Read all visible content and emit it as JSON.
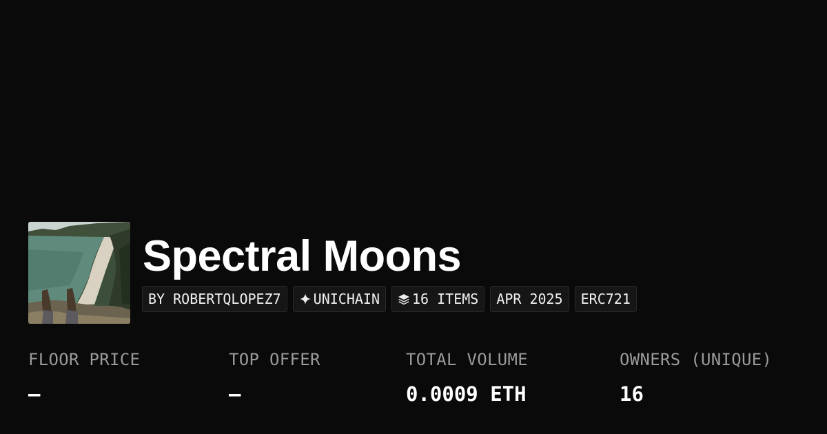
{
  "collection": {
    "title": "Spectral Moons",
    "image_icon": "landscape-photo"
  },
  "chips": {
    "creator": "BY ROBERTQLOPEZ7",
    "chain": "UNICHAIN",
    "chain_icon": "sparkle-icon",
    "items": "16 ITEMS",
    "items_icon": "layers-icon",
    "date": "APR 2025",
    "standard": "ERC721"
  },
  "stats": {
    "floor_price": {
      "label": "FLOOR PRICE",
      "value": "–"
    },
    "top_offer": {
      "label": "TOP OFFER",
      "value": "–"
    },
    "total_volume": {
      "label": "TOTAL VOLUME",
      "value": "0.0009 ETH"
    },
    "owners": {
      "label": "OWNERS (UNIQUE)",
      "value": "16"
    }
  },
  "colors": {
    "background": "#0a0a0a",
    "chip_background": "#161616",
    "label_gray": "#9a9a9a",
    "text_white": "#ffffff"
  }
}
